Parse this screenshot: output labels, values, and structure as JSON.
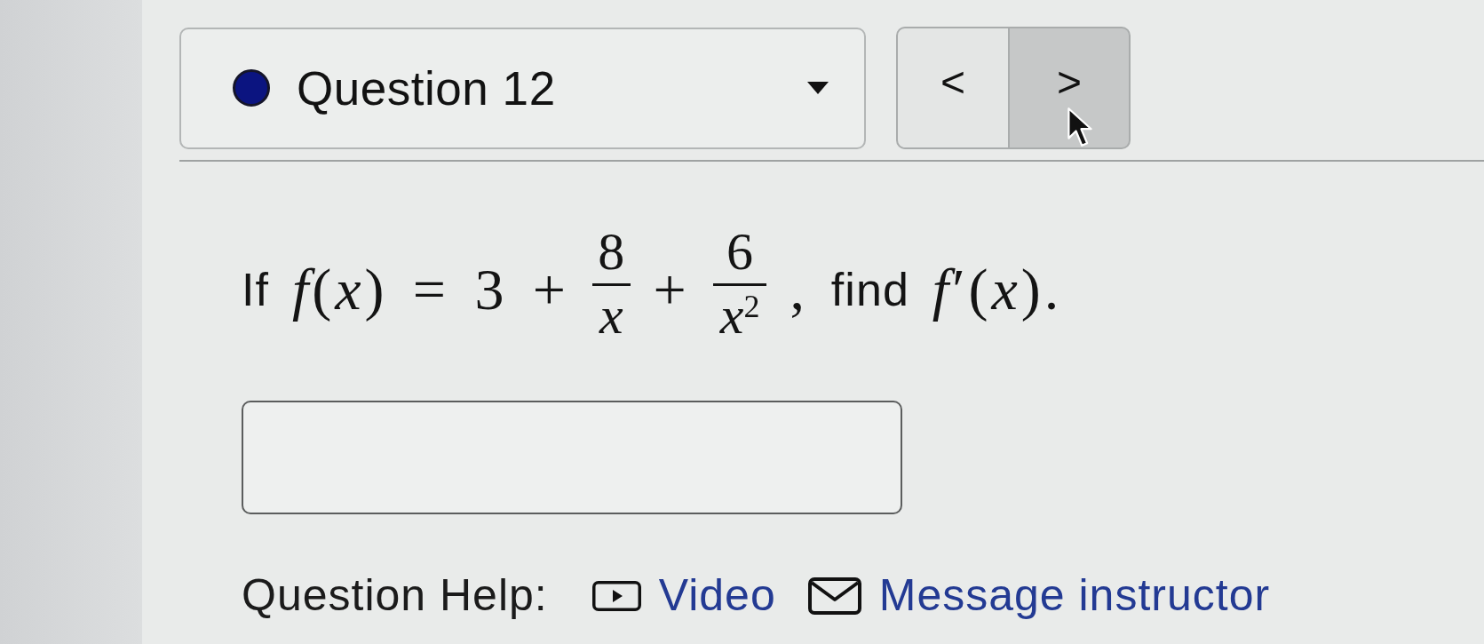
{
  "question_select": {
    "label": "Question 12"
  },
  "nav_buttons": [
    {
      "label": "<",
      "highlighted": false
    },
    {
      "label": ">",
      "highlighted": true
    }
  ],
  "question": [
    {
      "kind": "word",
      "text": "If"
    },
    {
      "kind": "math",
      "text": "*f*(*x*) = 3 +"
    },
    {
      "kind": "frac",
      "numerator": "8",
      "denominator": "*x*"
    },
    {
      "kind": "math",
      "text": "+"
    },
    {
      "kind": "frac",
      "numerator": "6",
      "denominator": "*x*$^{2}$"
    },
    {
      "kind": "math",
      "text": ","
    },
    {
      "kind": "word",
      "text": "find"
    },
    {
      "kind": "math",
      "text": "*f*′(*x*)."
    }
  ],
  "question_help": {
    "label": "Question Help:",
    "links": [
      {
        "kind": "video",
        "label": "Video"
      },
      {
        "kind": "message",
        "label": "Message instructor"
      }
    ]
  }
}
